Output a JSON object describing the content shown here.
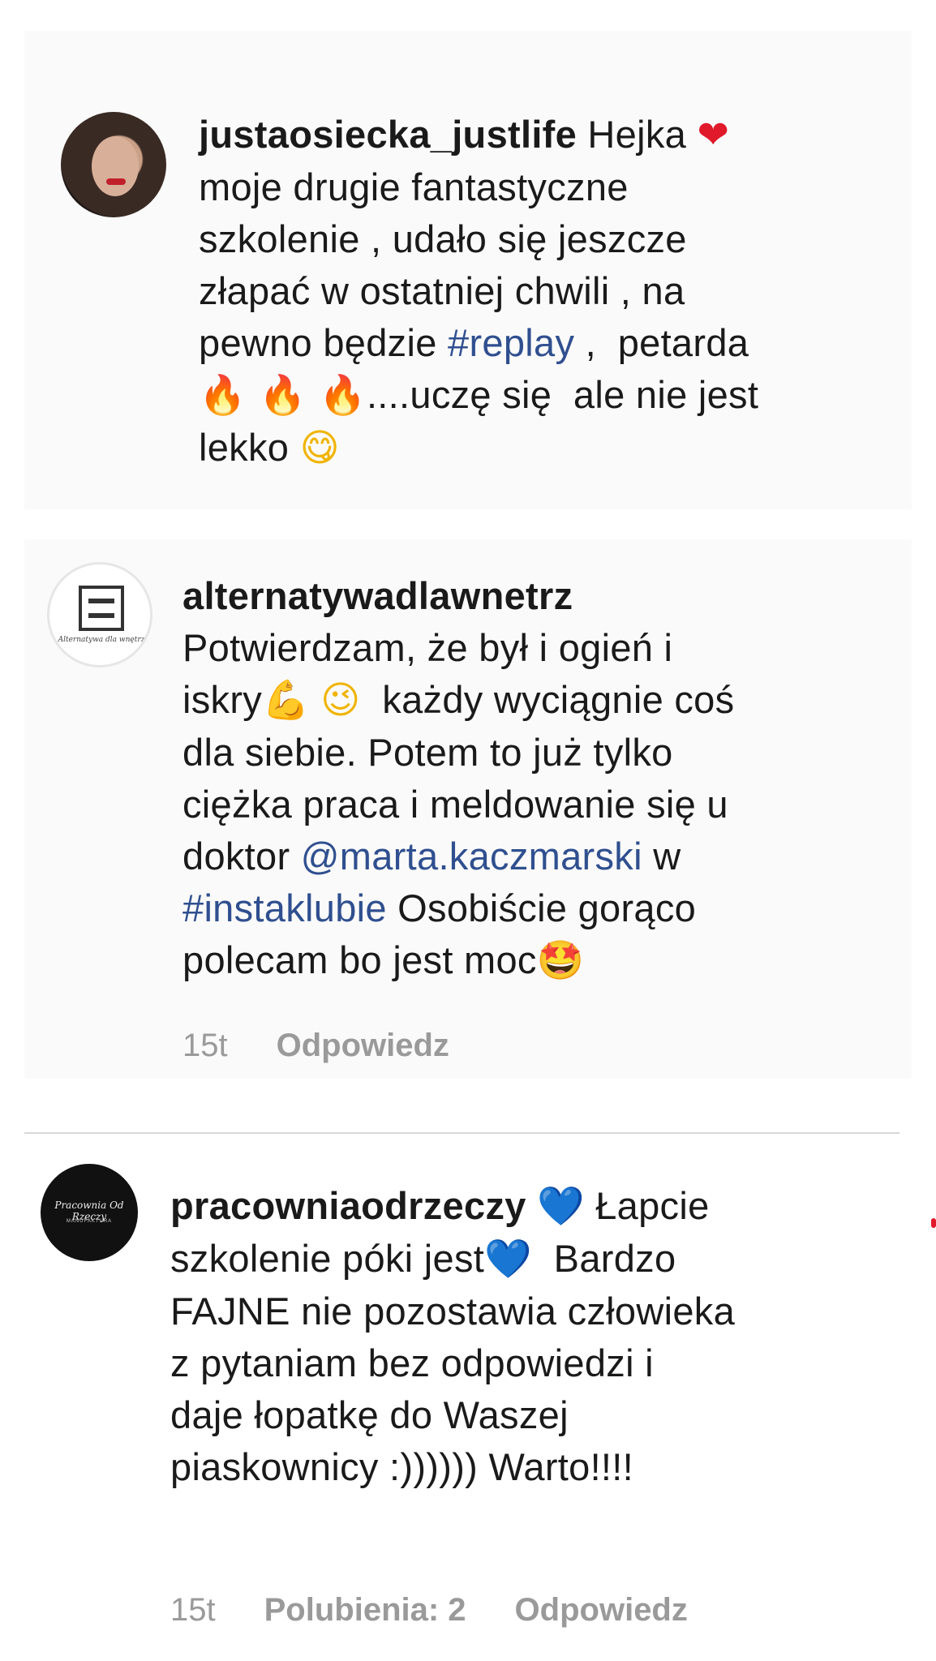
{
  "comments": [
    {
      "username": "justaosiecka_justlife",
      "avatar_icon": "profile-photo-woman",
      "text_parts": [
        " Hejka ",
        "❤",
        "\nmoje drugie fantastyczne\nszkolenie , udało się jeszcze\nzłapać w ostatniej chwili , na\npewno będzie ",
        "#replay",
        " ,  petarda\n",
        "🔥 🔥 🔥",
        "....uczę się  ale nie jest\nlekko ",
        "😋"
      ]
    },
    {
      "username": "alternatywadlawnetrz",
      "avatar_icon": "brand-logo-alternatywa",
      "avatar_text": "Alternatywa dla wnętrz",
      "text_parts": [
        "\nPotwierdzam, że był i ogień i\niskry",
        "💪",
        " ",
        "😉",
        "  każdy wyciągnie coś\ndla siebie. Potem to już tylko\nciężka praca i meldowanie się u\ndoktor ",
        "@marta.kaczmarski",
        " w\n",
        "#instaklubie",
        " Osobiście gorąco\npolecam bo jest moc",
        "🤩"
      ],
      "time": "15t",
      "reply_label": "Odpowiedz"
    },
    {
      "username": "pracowniaodrzeczy",
      "avatar_icon": "brand-logo-pracownia",
      "avatar_text": "Pracownia Od Rzeczy",
      "avatar_subtext": "MANUFAKTURA",
      "text_parts": [
        " ",
        "💙",
        " Łapcie\nszkolenie póki jest",
        "💙",
        "  Bardzo\nFAJNE nie pozostawia człowieka\nz pytaniam bez odpowiedzi i\ndaje łopatkę do Waszej\npiaskownicy :)))))) Warto!!!!"
      ],
      "time": "15t",
      "likes_label": "Polubienia: 2",
      "reply_label": "Odpowiedz"
    }
  ],
  "colors": {
    "link": "#2f4f8f",
    "meta": "#9a9a9a",
    "divider": "#d8d8d8"
  }
}
